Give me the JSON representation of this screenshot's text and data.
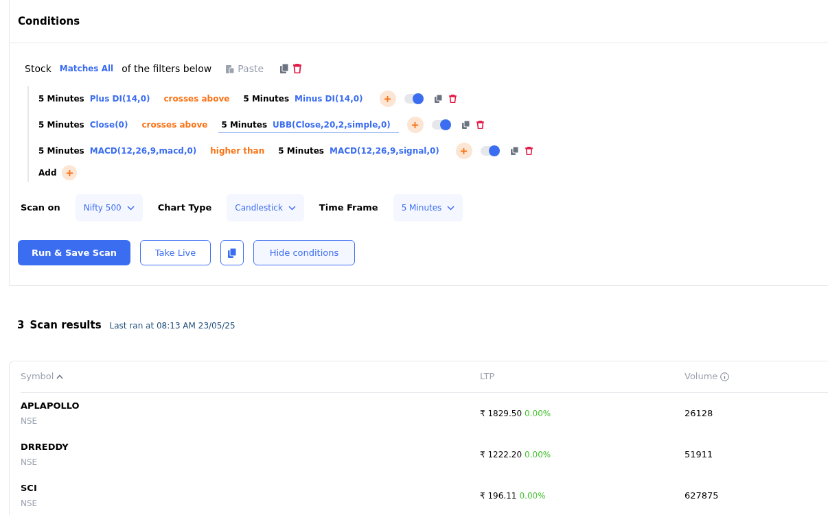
{
  "panel": {
    "title": "Conditions"
  },
  "filter": {
    "subject": "Stock",
    "match": "Matches All",
    "suffix": "of the filters below",
    "paste": "Paste"
  },
  "conditions": [
    {
      "left_tf": "5 Minutes",
      "left": "Plus DI(14,0)",
      "op": "crosses above",
      "right_tf": "5 Minutes",
      "right": "Minus DI(14,0)",
      "enabled": true,
      "editing": false
    },
    {
      "left_tf": "5 Minutes",
      "left": "Close(0)",
      "op": "crosses above",
      "right_tf": "5 Minutes",
      "right": "UBB(Close,20,2,simple,0)",
      "enabled": true,
      "editing": true
    },
    {
      "left_tf": "5 Minutes",
      "left": "MACD(12,26,9,macd,0)",
      "op": "higher than",
      "right_tf": "5 Minutes",
      "right": "MACD(12,26,9,signal,0)",
      "enabled": true,
      "editing": false
    }
  ],
  "add_label": "Add",
  "settings": [
    {
      "label": "Scan on",
      "value": "Nifty 500"
    },
    {
      "label": "Chart Type",
      "value": "Candlestick"
    },
    {
      "label": "Time Frame",
      "value": "5 Minutes"
    }
  ],
  "buttons": {
    "run": "Run & Save Scan",
    "live": "Take Live",
    "hide": "Hide conditions"
  },
  "results": {
    "count": "3",
    "title": "Scan results",
    "last_ran": "Last ran at 08:13 AM 23/05/25"
  },
  "table": {
    "columns": [
      "Symbol",
      "LTP",
      "Volume"
    ],
    "rows": [
      {
        "symbol": "APLAPOLLO",
        "exchange": "NSE",
        "ltp": "₹ 1829.50",
        "change": "0.00%",
        "volume": "26128"
      },
      {
        "symbol": "DRREDDY",
        "exchange": "NSE",
        "ltp": "₹ 1222.20",
        "change": "0.00%",
        "volume": "51911"
      },
      {
        "symbol": "SCI",
        "exchange": "NSE",
        "ltp": "₹ 196.11",
        "change": "0.00%",
        "volume": "627875"
      }
    ]
  }
}
